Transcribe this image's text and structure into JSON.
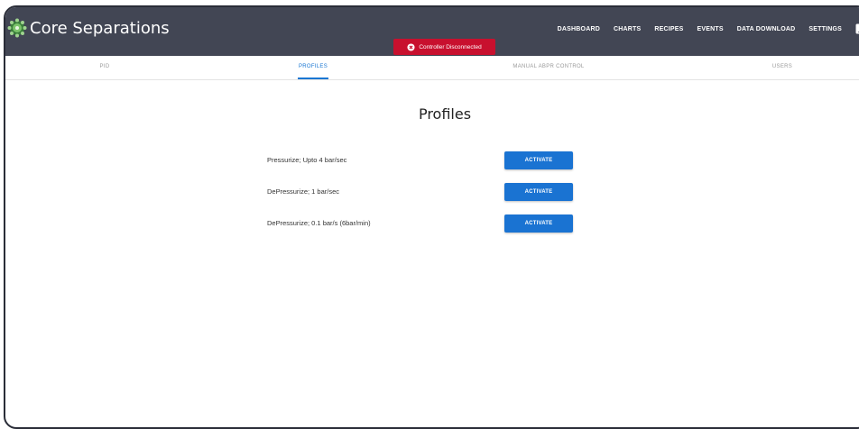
{
  "app": {
    "brand": "Core Separations",
    "nav": [
      "DASHBOARD",
      "CHARTS",
      "RECIPES",
      "EVENTS",
      "DATA DOWNLOAD",
      "SETTINGS"
    ],
    "alert": "Controller Disconnected"
  },
  "tabs": [
    {
      "label": "PID"
    },
    {
      "label": "PROFILES",
      "active": true
    },
    {
      "label": "MANUAL ABPR CONTROL"
    },
    {
      "label": "USERS"
    }
  ],
  "main": {
    "title": "Profiles",
    "profiles": [
      {
        "name": "Pressurize; Upto 4 bar/sec",
        "button": "ACTIVATE"
      },
      {
        "name": "DePressurize; 1 bar/sec",
        "button": "ACTIVATE"
      },
      {
        "name": "DePressurize; 0.1 bar/s (6bar/min)",
        "button": "ACTIVATE"
      }
    ]
  },
  "colors": {
    "appbar": "#424654",
    "accent": "#1976d2",
    "alert": "#c8102e"
  }
}
